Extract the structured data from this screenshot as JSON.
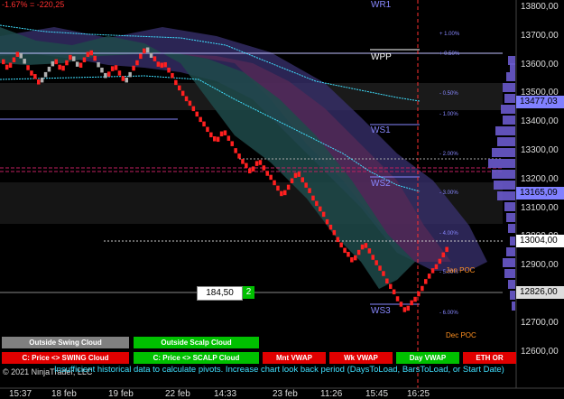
{
  "header": {
    "pnl_text": "-1.67% = -220,25"
  },
  "price_axis": {
    "labels": [
      "13800,00",
      "13700,00",
      "13600,00",
      "13500,00",
      "13400,00",
      "13300,00",
      "13200,00",
      "13100,00",
      "13000,00",
      "12900,00",
      "12800,00",
      "12700,00",
      "12600,00"
    ],
    "tags": {
      "upper_blue": "13477,03",
      "mid_blue": "13165,09",
      "last_price": "13004,00",
      "poc": "12826,00"
    }
  },
  "time_axis": {
    "labels": [
      "15:37",
      "18 feb",
      "19 feb",
      "22 feb",
      "14:33",
      "23 feb",
      "11:26",
      "15:45",
      "16:25"
    ]
  },
  "levels": {
    "wr1": "WR1",
    "wpp": "WPP",
    "ws1": "WS1",
    "ws2": "WS2",
    "ws3": "WS3"
  },
  "percent_levels": [
    "+ 1.00%",
    "+ 0.50%",
    "- 0.50%",
    "- 1.00%",
    "- 2.00%",
    "- 3.00%",
    "- 4.00%",
    "- 5.00%",
    "- 6.00%"
  ],
  "annotations": {
    "jan_poc": "Jan POC",
    "dec_poc": "Dec POC"
  },
  "order_box": {
    "price": "184,50",
    "qty": "2"
  },
  "buttons": {
    "outside_swing": "Outside Swing Cloud",
    "outside_scalp": "Outside Scalp Cloud",
    "swing_cloud": "C: Price <> SWING Cloud",
    "scalp_cloud": "C: Price <> SCALP Cloud",
    "mnt_vwap": "Mnt VWAP",
    "wk_vwap": "Wk VWAP",
    "day_vwap": "Day VWAP",
    "eth_or": "ETH OR"
  },
  "footer": {
    "copyright": "© 2021 NinjaTrader, LLC",
    "warning": "Insufficient historical data to calculate pivots. Increase chart look back period (DaysToLoad, BarsToLoad, or Start Date)"
  },
  "colors": {
    "up": "#ff2020",
    "down": "#ff2020",
    "cyan": "#40e0ff",
    "cloud": "#4a3a7a",
    "cloud2": "#6a2a5a",
    "green": "#00c000"
  },
  "chart_data": {
    "type": "line",
    "title": "",
    "xlabel": "",
    "ylabel": "",
    "ylim": [
      12530,
      13840
    ],
    "x_ticks": [
      "15:37",
      "18 feb",
      "19 feb",
      "22 feb",
      "14:33",
      "23 feb",
      "11:26",
      "15:45",
      "16:25"
    ],
    "series": [
      {
        "values": [
          13640,
          13610,
          13660,
          13620,
          13590,
          13560,
          13640,
          13600,
          13650,
          13610,
          13670,
          13630,
          13580,
          13620,
          13560,
          13600,
          13640,
          13680,
          13650,
          13610,
          13630,
          13570,
          13500,
          13430,
          13380,
          13360,
          13400,
          13340,
          13290,
          13260,
          13300,
          13250,
          13180,
          13220,
          13260,
          13180,
          13100,
          13040,
          12990,
          12960,
          13020,
          12980,
          12900,
          12840,
          12790,
          12820,
          12880,
          12930,
          12970,
          13010
        ]
      }
    ]
  }
}
